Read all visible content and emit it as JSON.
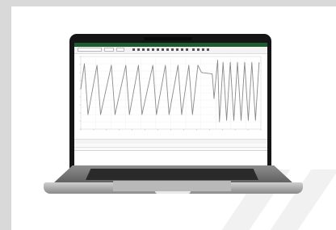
{
  "chart_data": {
    "type": "line",
    "title": "",
    "xlabel": "",
    "ylabel": "",
    "xlim": [
      0,
      100
    ],
    "ylim": [
      0,
      100
    ],
    "grid": true,
    "legend": "none",
    "series": [
      {
        "color": "#8a8a8a",
        "x": [
          0,
          2,
          4,
          9,
          11,
          17,
          19,
          25,
          27,
          32,
          34,
          40,
          42,
          47,
          49,
          54,
          56,
          60,
          62,
          65,
          67,
          73,
          74,
          76,
          77,
          79,
          81,
          83,
          85,
          87,
          89,
          91,
          93,
          95,
          97,
          99
        ],
        "y": [
          55,
          90,
          20,
          88,
          20,
          88,
          20,
          88,
          20,
          88,
          20,
          88,
          20,
          88,
          20,
          88,
          20,
          88,
          20,
          88,
          78,
          76,
          42,
          95,
          10,
          92,
          12,
          92,
          12,
          92,
          12,
          92,
          12,
          92,
          12,
          92
        ]
      }
    ]
  },
  "colors": {
    "titlebar": "#1e5b2e",
    "line": "#8a8a8a",
    "bezel": "#151515"
  },
  "icons": [
    "laptop-icon"
  ]
}
